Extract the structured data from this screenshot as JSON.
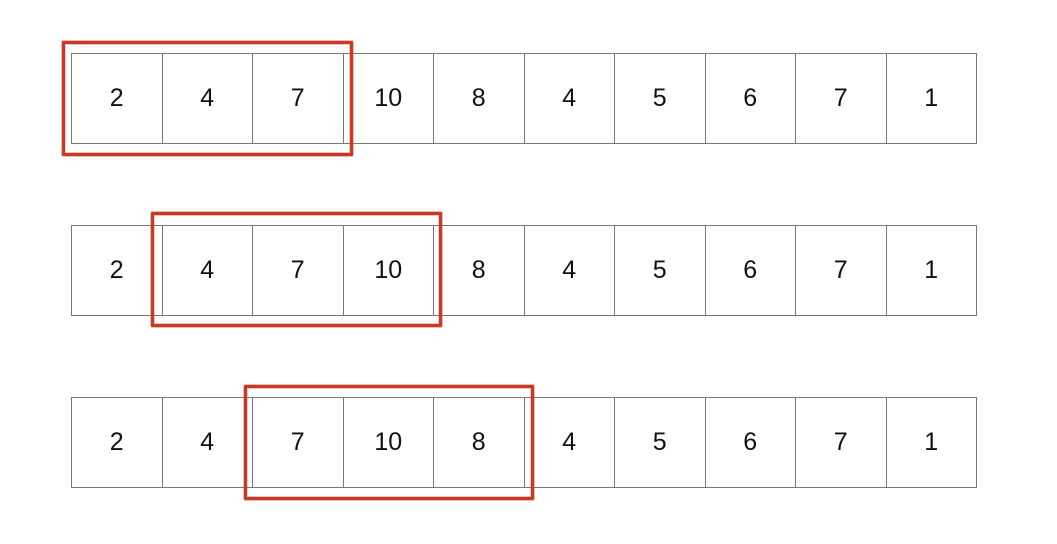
{
  "diagram": {
    "rows": [
      {
        "cells": [
          "2",
          "4",
          "7",
          "10",
          "8",
          "4",
          "5",
          "6",
          "7",
          "1"
        ],
        "window": {
          "start": 0,
          "length": 3
        }
      },
      {
        "cells": [
          "2",
          "4",
          "7",
          "10",
          "8",
          "4",
          "5",
          "6",
          "7",
          "1"
        ],
        "window": {
          "start": 1,
          "length": 3
        }
      },
      {
        "cells": [
          "2",
          "4",
          "7",
          "10",
          "8",
          "4",
          "5",
          "6",
          "7",
          "1"
        ],
        "window": {
          "start": 2,
          "length": 3
        }
      }
    ],
    "window_color": "#c63a26"
  }
}
